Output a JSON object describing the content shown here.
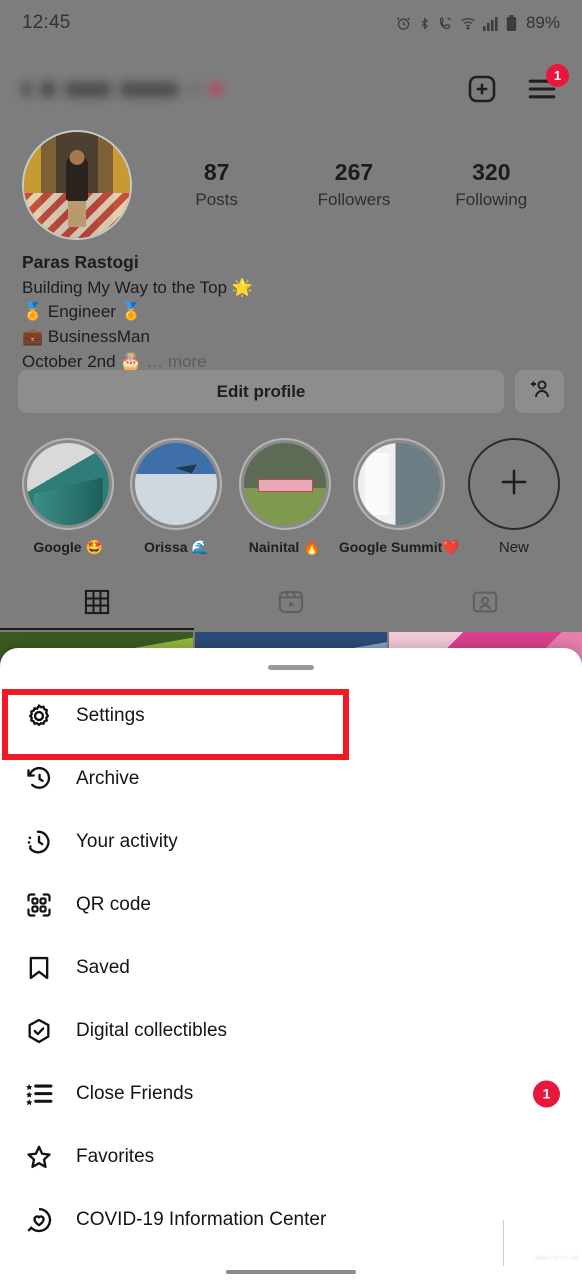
{
  "status_bar": {
    "time": "12:45",
    "battery_percent": "89%",
    "icons": [
      "alarm-icon",
      "bluetooth-icon",
      "call-icon",
      "wifi-icon",
      "signal-icon",
      "battery-icon"
    ]
  },
  "app_bar": {
    "username_redacted": true,
    "add_label": "+",
    "menu_badge": "1"
  },
  "profile": {
    "stats": [
      {
        "value": "87",
        "label": "Posts"
      },
      {
        "value": "267",
        "label": "Followers"
      },
      {
        "value": "320",
        "label": "Following"
      }
    ],
    "display_name": "Paras Rastogi",
    "bio_lines": [
      "Building My Way to the Top 🌟",
      "🏅 Engineer 🏅",
      "💼 BusinessMan"
    ],
    "bio_last_line": "October 2nd 🎂",
    "bio_more": "… more",
    "edit_profile_label": "Edit profile",
    "add_person_icon": "add-person-icon"
  },
  "highlights": [
    {
      "label": "Google 🤩",
      "image_class": "img-google"
    },
    {
      "label": "Orissa 🌊",
      "image_class": "img-orissa"
    },
    {
      "label": "Nainital 🔥",
      "image_class": "img-nainital"
    },
    {
      "label": "Google Summit❤️",
      "image_class": "img-summit"
    }
  ],
  "new_highlight": {
    "label": "New",
    "icon": "plus-icon"
  },
  "tabs": [
    {
      "name": "grid-tab",
      "icon": "grid-icon",
      "active": true
    },
    {
      "name": "reels-tab",
      "icon": "reels-icon",
      "active": false
    },
    {
      "name": "tagged-tab",
      "icon": "tagged-icon",
      "active": false
    }
  ],
  "sheet": {
    "menu_items": [
      {
        "label": "Settings",
        "icon": "gear-icon",
        "badge": null,
        "highlighted": true
      },
      {
        "label": "Archive",
        "icon": "archive-clock-icon",
        "badge": null,
        "highlighted": false
      },
      {
        "label": "Your activity",
        "icon": "activity-clock-icon",
        "badge": null,
        "highlighted": false
      },
      {
        "label": "QR code",
        "icon": "qr-code-icon",
        "badge": null,
        "highlighted": false
      },
      {
        "label": "Saved",
        "icon": "bookmark-icon",
        "badge": null,
        "highlighted": false
      },
      {
        "label": "Digital collectibles",
        "icon": "hexagon-check-icon",
        "badge": null,
        "highlighted": false
      },
      {
        "label": "Close Friends",
        "icon": "star-list-icon",
        "badge": "1",
        "highlighted": false
      },
      {
        "label": "Favorites",
        "icon": "star-icon",
        "badge": null,
        "highlighted": false
      },
      {
        "label": "COVID-19 Information Center",
        "icon": "covid-heart-icon",
        "badge": null,
        "highlighted": false
      }
    ]
  },
  "colors": {
    "dim_overlay": "#7d7d7d",
    "sheet_background": "#ffffff",
    "badge_red": "#e8173d",
    "annotation_red": "#ef1b24",
    "text_primary": "#151515"
  }
}
